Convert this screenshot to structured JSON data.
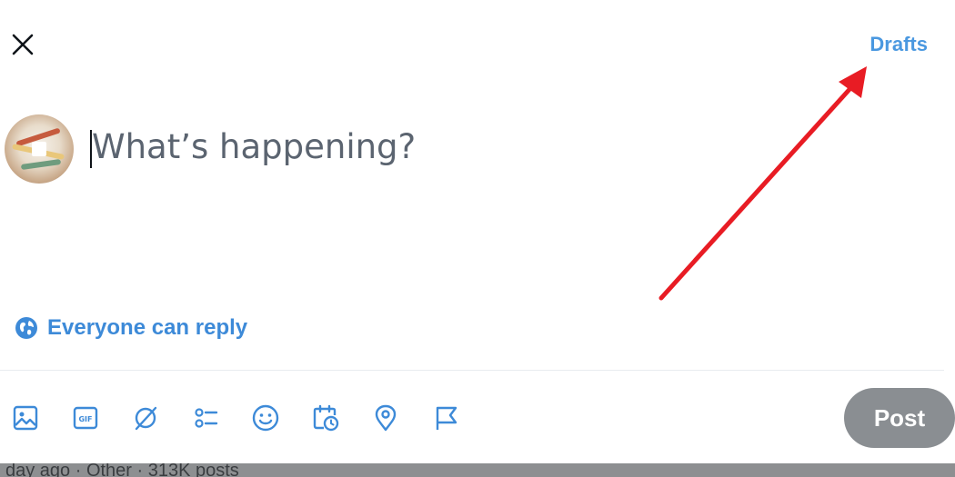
{
  "header": {
    "close_icon": "close-icon",
    "drafts_label": "Drafts"
  },
  "composer": {
    "avatar": "user-avatar",
    "placeholder": "What’s happening?"
  },
  "reply_setting": {
    "icon": "globe-icon",
    "label": "Everyone can reply"
  },
  "toolbar": {
    "items": [
      "image-icon",
      "gif-icon",
      "grok-icon",
      "poll-icon",
      "emoji-icon",
      "schedule-icon",
      "location-icon",
      "flag-icon"
    ],
    "post_label": "Post"
  },
  "background": {
    "trend_meta": "day ago · Other · 313K posts"
  },
  "annotation": {
    "arrow_color": "#e81c24"
  },
  "colors": {
    "accent": "#1d9bf0",
    "post_disabled": "#8a8e92"
  }
}
